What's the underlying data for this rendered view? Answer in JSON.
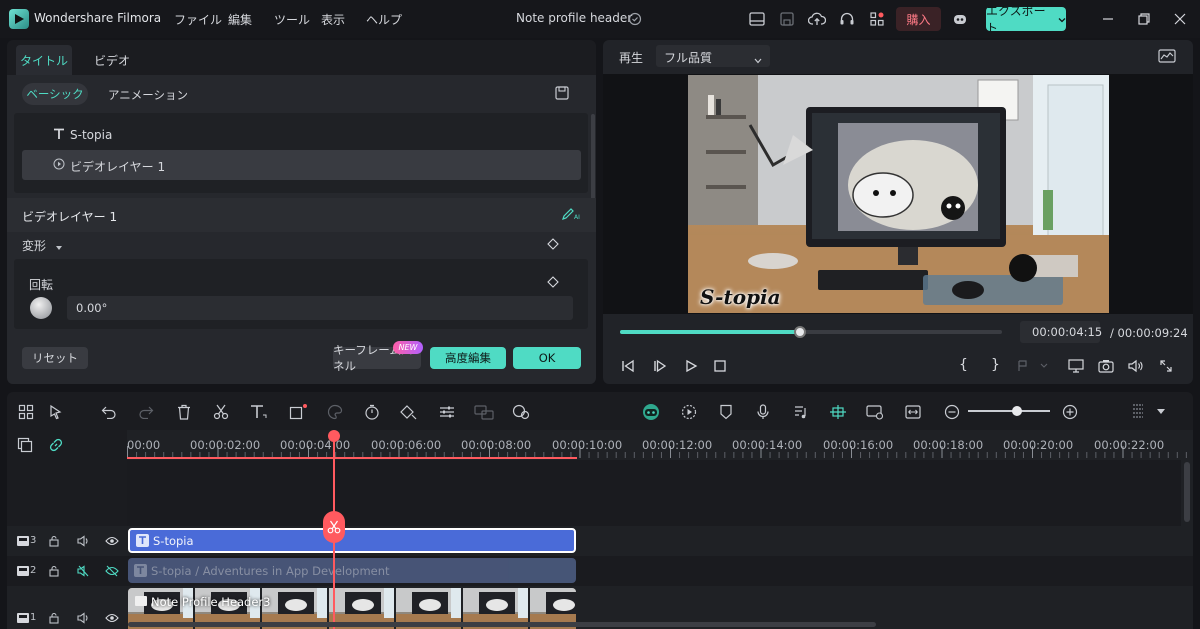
{
  "app": {
    "name": "Wondershare Filmora",
    "project_title": "Note profile header"
  },
  "menu": [
    "ファイル",
    "編集",
    "ツール",
    "表示",
    "ヘルプ"
  ],
  "header_buttons": {
    "buy": "購入",
    "export": "エクスポート"
  },
  "left_panel": {
    "tabs": [
      "タイトル",
      "ビデオ"
    ],
    "subtabs": [
      "ベーシック",
      "アニメーション"
    ],
    "layers": [
      {
        "label": "S-topia",
        "icon": "text-icon"
      },
      {
        "label": "ビデオレイヤー 1",
        "icon": "play-circle-icon"
      }
    ],
    "section_title": "ビデオレイヤー 1",
    "transform_label": "変形",
    "rotation_label": "回転",
    "rotation_value": "0.00°",
    "reset_label": "リセット",
    "keyframe_label": "キーフレームパネル",
    "new_badge": "NEW",
    "advanced_label": "高度編集",
    "ok_label": "OK"
  },
  "preview": {
    "play_label": "再生",
    "quality": "フル品質",
    "overlay_text": "S-topia",
    "current_time": "00:00:04:15",
    "total_time": "/ 00:00:09:24",
    "progress": 0.47
  },
  "timeline": {
    "ruler": [
      "00:00",
      "00:00:02:00",
      "00:00:04:00",
      "00:00:06:00",
      "00:00:08:00",
      "00:00:10:00",
      "00:00:12:00",
      "00:00:14:00",
      "00:00:16:00",
      "00:00:18:00",
      "00:00:20:00",
      "00:00:22:00"
    ],
    "tracks": [
      {
        "number": "3",
        "clip": "S-topia"
      },
      {
        "number": "2",
        "clip": "S-topia / Adventures in App Development"
      },
      {
        "number": "1",
        "clip": "Note Profile Header3"
      }
    ]
  },
  "colors": {
    "accent": "#4fdbc4",
    "buy_red": "#ff7a86",
    "playhead": "#ff5a5f",
    "title_clip": "#4a6bd8",
    "title_clip2": "#4f5f86"
  }
}
